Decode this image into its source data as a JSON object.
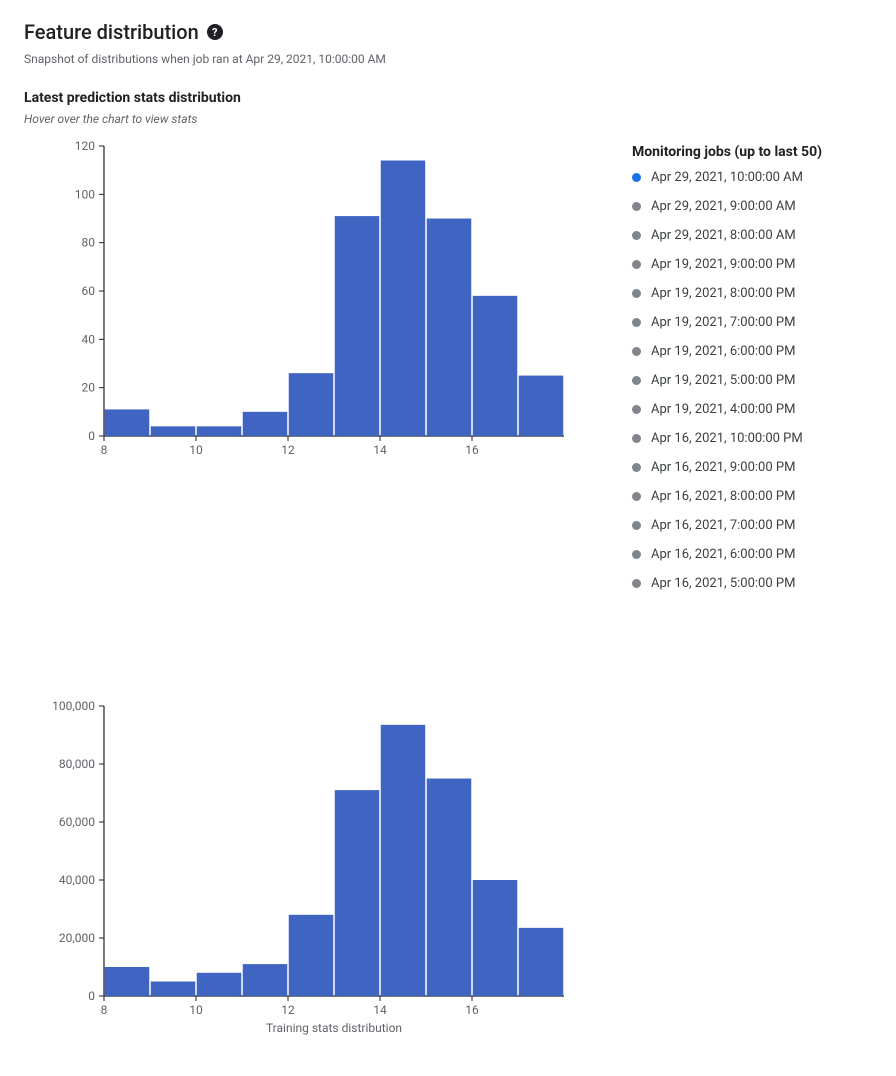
{
  "header": {
    "title": "Feature distribution",
    "help_icon": "?",
    "subtitle": "Snapshot of distributions when job ran at Apr 29, 2021, 10:00:00 AM"
  },
  "section": {
    "title": "Latest prediction stats distribution",
    "hint": "Hover over the chart to view stats"
  },
  "legend": {
    "title": "Monitoring jobs (up to last 50)",
    "selected_index": 0,
    "items": [
      "Apr 29, 2021, 10:00:00 AM",
      "Apr 29, 2021, 9:00:00 AM",
      "Apr 29, 2021, 8:00:00 AM",
      "Apr 19, 2021, 9:00:00 PM",
      "Apr 19, 2021, 8:00:00 PM",
      "Apr 19, 2021, 7:00:00 PM",
      "Apr 19, 2021, 6:00:00 PM",
      "Apr 19, 2021, 5:00:00 PM",
      "Apr 19, 2021, 4:00:00 PM",
      "Apr 16, 2021, 10:00:00 PM",
      "Apr 16, 2021, 9:00:00 PM",
      "Apr 16, 2021, 8:00:00 PM",
      "Apr 16, 2021, 7:00:00 PM",
      "Apr 16, 2021, 6:00:00 PM",
      "Apr 16, 2021, 5:00:00 PM"
    ]
  },
  "chart_data": [
    {
      "type": "bar",
      "title": "",
      "xlabel": "",
      "ylabel": "",
      "categories": [
        8,
        9,
        10,
        11,
        12,
        13,
        14,
        15,
        16,
        17
      ],
      "values": [
        11,
        4,
        4,
        10,
        26,
        91,
        114,
        90,
        58,
        25
      ],
      "xticks": [
        8,
        10,
        12,
        14,
        16
      ],
      "yticks": [
        0,
        20,
        40,
        60,
        80,
        100,
        120
      ],
      "xlim": [
        8,
        18
      ],
      "ylim": [
        0,
        120
      ]
    },
    {
      "type": "bar",
      "title": "",
      "xlabel": "Training stats distribution",
      "ylabel": "",
      "categories": [
        8,
        9,
        10,
        11,
        12,
        13,
        14,
        15,
        16,
        17
      ],
      "values": [
        10000,
        5000,
        8000,
        11000,
        28000,
        71000,
        93500,
        75000,
        40000,
        23500
      ],
      "xticks": [
        8,
        10,
        12,
        14,
        16
      ],
      "yticks": [
        0,
        20000,
        40000,
        60000,
        80000,
        100000
      ],
      "xlim": [
        8,
        18
      ],
      "ylim": [
        0,
        100000
      ]
    }
  ],
  "colors": {
    "bar": "#3f64c2",
    "selected": "#1a73e8",
    "dot": "#80868b"
  }
}
